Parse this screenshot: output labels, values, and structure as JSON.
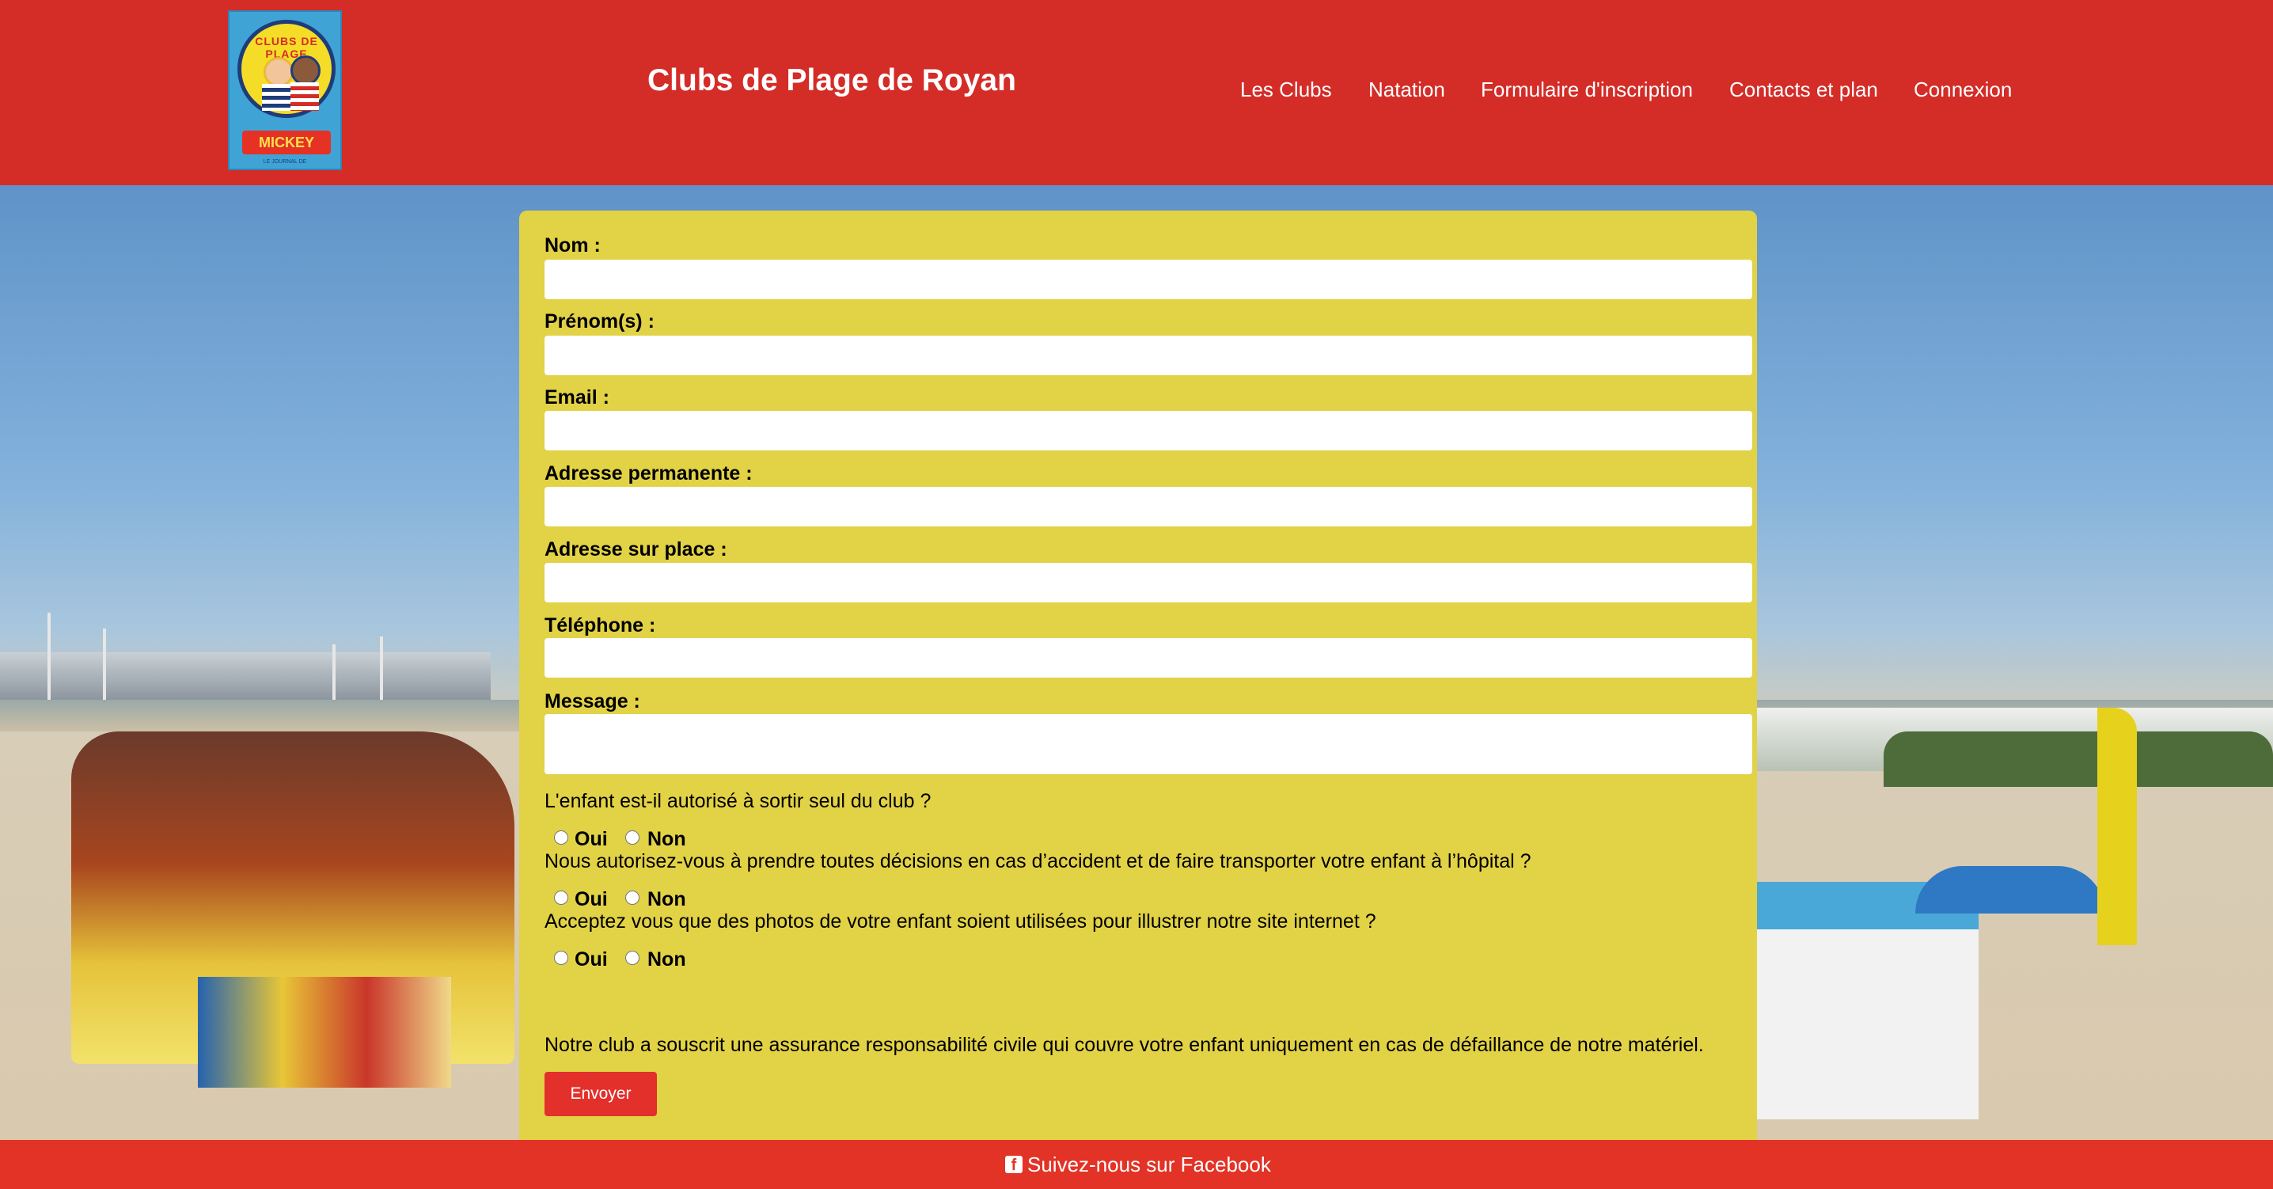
{
  "header": {
    "logo_alt": "Clubs de Plage - Le Journal de Mickey",
    "logo_text_top": "CLUBS DE PLAGE",
    "logo_text_brand": "MICKEY",
    "logo_text_small": "LE JOURNAL DE",
    "title": "Clubs de Plage de Royan",
    "nav": [
      {
        "label": "Les Clubs"
      },
      {
        "label": "Natation"
      },
      {
        "label": "Formulaire d'inscription"
      },
      {
        "label": "Contacts et plan"
      },
      {
        "label": "Connexion"
      }
    ]
  },
  "form": {
    "fields": [
      {
        "label": "Nom :",
        "value": ""
      },
      {
        "label": "Prénom(s) :",
        "value": ""
      },
      {
        "label": "Email :",
        "value": ""
      },
      {
        "label": "Adresse permanente :",
        "value": ""
      },
      {
        "label": "Adresse sur place :",
        "value": ""
      },
      {
        "label": "Téléphone :",
        "value": ""
      },
      {
        "label": "Message :",
        "value": ""
      }
    ],
    "questions": [
      {
        "text": "L'enfant est-il autorisé à sortir seul du club ?",
        "yes": "Oui",
        "no": "Non"
      },
      {
        "text": "Nous autorisez-vous à prendre toutes décisions en cas d’accident et de faire transporter votre enfant à l’hôpital ?",
        "yes": "Oui",
        "no": "Non"
      },
      {
        "text": "Acceptez vous que des photos de votre enfant soient utilisées pour illustrer notre site internet ?",
        "yes": "Oui",
        "no": "Non"
      }
    ],
    "note": "Notre club a souscrit une assurance responsabilité civile qui couvre votre enfant uniquement en cas de défaillance de notre matériel.",
    "submit_label": "Envoyer"
  },
  "footer": {
    "icon": "facebook-icon",
    "link_label": "Suivez-nous sur Facebook"
  },
  "colors": {
    "header_bg": "#d42c27",
    "panel_bg": "#e2d245",
    "button_bg": "#e3302a",
    "footer_bg": "#e33226"
  }
}
